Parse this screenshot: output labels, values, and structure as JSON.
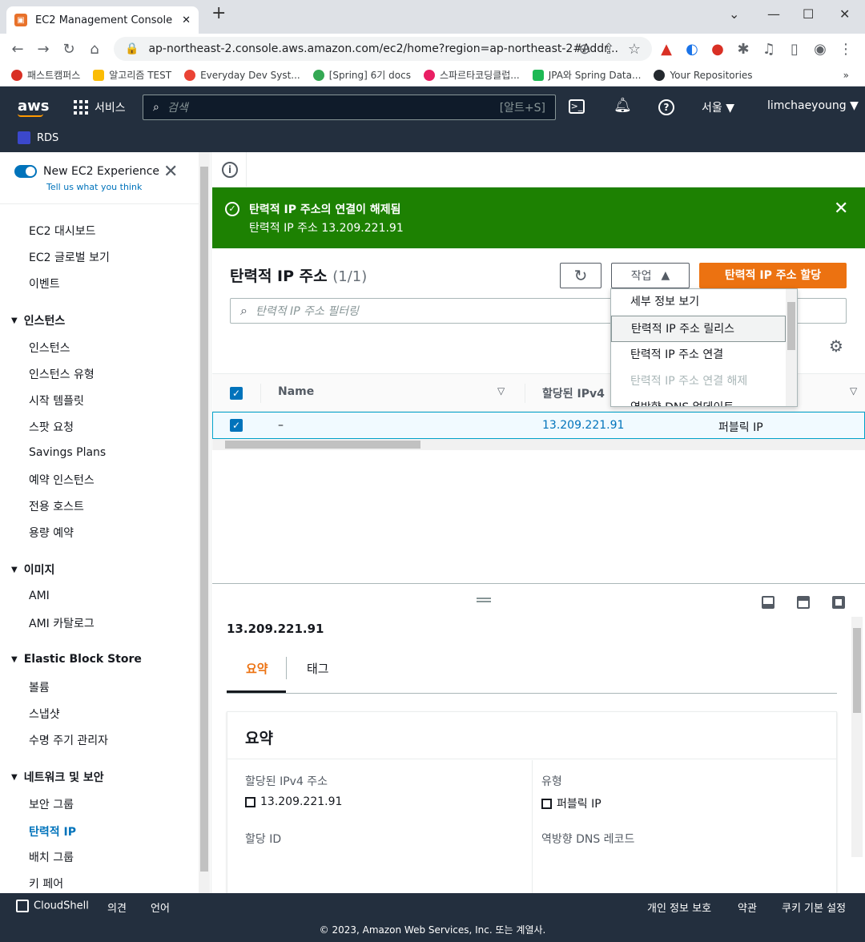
{
  "browser": {
    "tab_title": "EC2 Management Console",
    "url": "ap-northeast-2.console.aws.amazon.com/ec2/home?region=ap-northeast-2#Addr...",
    "bookmarks": [
      "패스트캠퍼스",
      "알고리즘 TEST",
      "Everyday Dev Syst...",
      "[Spring] 6기 docs",
      "스파르타코딩클럽...",
      "JPA와 Spring Data...",
      "Your Repositories"
    ]
  },
  "aws_nav": {
    "logo": "aws",
    "services": "서비스",
    "search_placeholder": "검색",
    "search_shortcut": "[알트+S]",
    "region": "서울 ▼",
    "user": "limchaeyoung ▼",
    "favorite": "RDS"
  },
  "sidebar": {
    "new_experience": "New EC2 Experience",
    "tell_us": "Tell us what you think",
    "top_items": [
      "EC2 대시보드",
      "EC2 글로벌 보기",
      "이벤트"
    ],
    "sections": [
      {
        "title": "인스턴스",
        "items": [
          "인스턴스",
          "인스턴스 유형",
          "시작 템플릿",
          "스팟 요청",
          "Savings Plans",
          "예약 인스턴스",
          "전용 호스트",
          "용량 예약"
        ]
      },
      {
        "title": "이미지",
        "items": [
          "AMI",
          "AMI 카탈로그"
        ]
      },
      {
        "title": "Elastic Block Store",
        "items": [
          "볼륨",
          "스냅샷",
          "수명 주기 관리자"
        ]
      },
      {
        "title": "네트워크 및 보안",
        "items": [
          "보안 그룹",
          "탄력적 IP",
          "배치 그룹",
          "키 페어"
        ]
      }
    ]
  },
  "flash": {
    "title": "탄력적 IP 주소의 연결이 해제됨",
    "message": "탄력적 IP 주소 13.209.221.91"
  },
  "table": {
    "title": "탄력적 IP 주소",
    "count": "(1/1)",
    "actions_label": "작업",
    "allocate_label": "탄력적 IP 주소 할당",
    "filter_placeholder": "탄력적 IP 주소 필터링",
    "columns": [
      "Name",
      "할당된 IPv4"
    ],
    "row": {
      "name": "–",
      "ipv4": "13.209.221.91",
      "type": "퍼블릭 IP"
    }
  },
  "actions_menu": [
    "세부 정보 보기",
    "탄력적 IP 주소 릴리스",
    "탄력적 IP 주소 연결",
    "탄력적 IP 주소 연결 해제",
    "역방향 DNS 업데이트"
  ],
  "detail": {
    "ip": "13.209.221.91",
    "tabs": [
      "요약",
      "태그"
    ],
    "summary_title": "요약",
    "fields": {
      "ipv4_label": "할당된 IPv4 주소",
      "ipv4_value": "13.209.221.91",
      "type_label": "유형",
      "type_value": "퍼블릭 IP",
      "alloc_label": "할당 ID",
      "rdns_label": "역방향 DNS 레코드"
    }
  },
  "footer": {
    "cloudshell": "CloudShell",
    "feedback": "의견",
    "language": "언어",
    "privacy": "개인 정보 보호",
    "terms": "약관",
    "cookies": "쿠키 기본 설정",
    "copyright": "© 2023, Amazon Web Services, Inc. 또는 계열사."
  }
}
